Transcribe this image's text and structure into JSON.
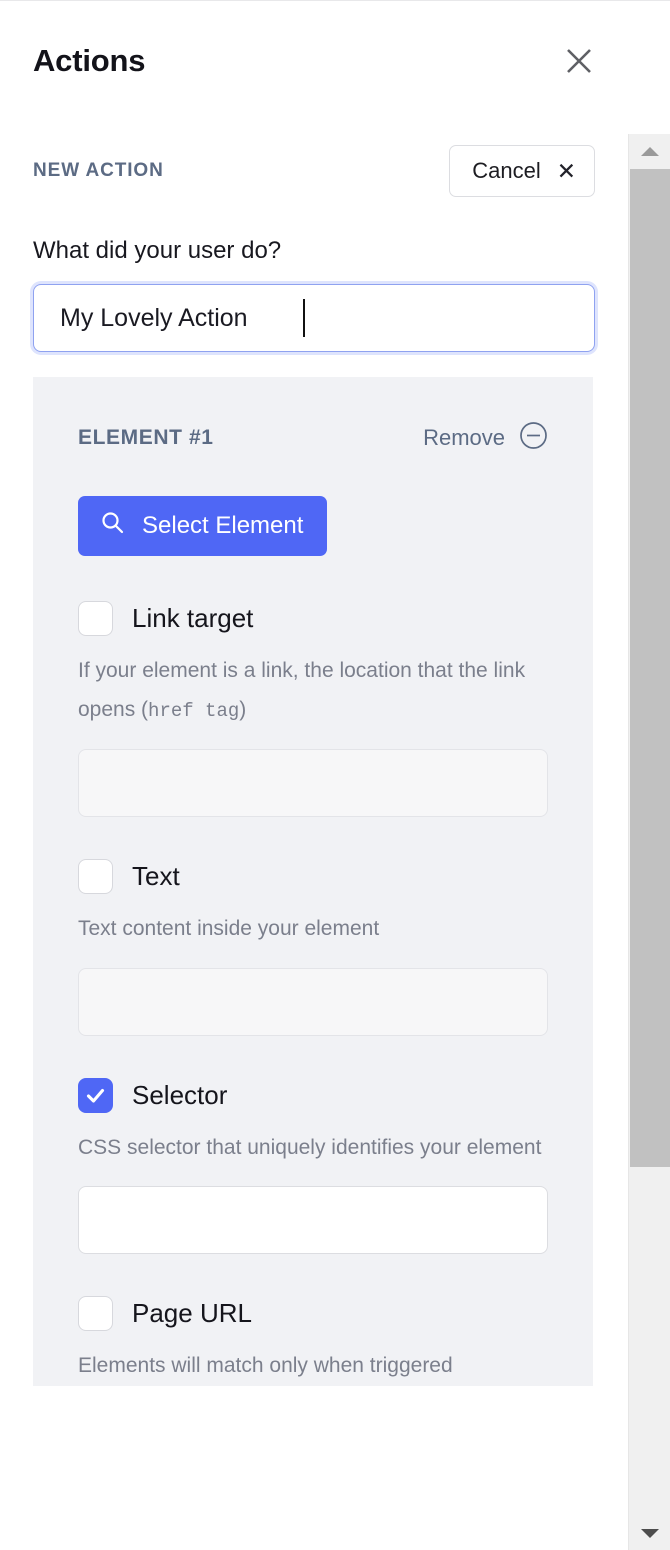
{
  "header": {
    "title": "Actions",
    "close_icon": "close-icon"
  },
  "section": {
    "label": "NEW ACTION",
    "cancel_label": "Cancel",
    "cancel_x": "✕"
  },
  "form": {
    "question": "What did your user do?",
    "action_name_value": "My Lovely Action",
    "action_name_placeholder": ""
  },
  "element_card": {
    "title": "ELEMENT #1",
    "remove_label": "Remove",
    "remove_icon": "minus-circle-icon",
    "select_element_label": "Select Element",
    "select_element_icon": "search-icon",
    "fields": [
      {
        "label": "Link target",
        "checked": false,
        "help_prefix": "If your element is a link, the location that the link opens (",
        "help_mono": "href tag",
        "help_suffix": ")",
        "value": "",
        "placeholder": ""
      },
      {
        "label": "Text",
        "checked": false,
        "help_prefix": "Text content inside your element",
        "help_mono": "",
        "help_suffix": "",
        "value": "",
        "placeholder": ""
      },
      {
        "label": "Selector",
        "checked": true,
        "help_prefix": "CSS selector that uniquely identifies your element",
        "help_mono": "",
        "help_suffix": "",
        "value": "",
        "placeholder": ""
      },
      {
        "label": "Page URL",
        "checked": false,
        "help_prefix": "Elements will match only when triggered",
        "help_mono": "",
        "help_suffix": "",
        "value": "",
        "placeholder": ""
      }
    ]
  },
  "scrollbar": {
    "up_icon": "triangle-up-icon",
    "down_icon": "triangle-down-icon"
  },
  "colors": {
    "accent": "#4f67f5",
    "section_label": "#5c6b84",
    "card_bg": "#f1f2f5",
    "help_text": "#7b7f8c"
  }
}
